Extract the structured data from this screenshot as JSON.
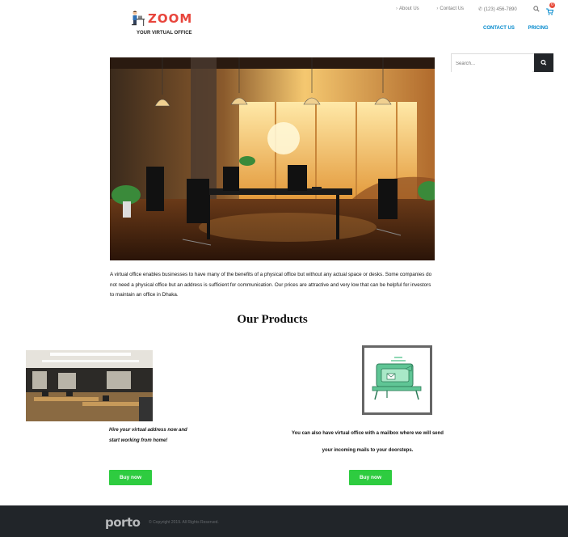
{
  "header": {
    "logo_word": "ZOOM",
    "logo_tagline": "YOUR VIRTUAL OFFICE",
    "top_links": [
      "About Us",
      "Contact Us"
    ],
    "phone": "(123) 456-7890",
    "cart_count": "0",
    "nav": [
      "CONTACT US",
      "PRICING"
    ]
  },
  "search": {
    "placeholder": "Search..."
  },
  "intro": "A virtual office enables businesses to have many of the benefits of a physical office but without any actual space or desks. Some companies do not need a physical office but an address is sufficient for communication. Our prices are attractive and very low that can be helpful for investors to maintain an office in Dhaka.",
  "products": {
    "title": "Our Products",
    "items": [
      {
        "text": "Hire your virtual address now and start working from home!",
        "button": "Buy now"
      },
      {
        "text": "You can also have virtual office with a mailbox where we will send your incoming mails to your doorsteps.",
        "button": "Buy now"
      }
    ]
  },
  "footer": {
    "logo": "porto",
    "copyright": "© Copyright 2019. All Rights Reserved."
  },
  "colors": {
    "accent": "#0088cc",
    "brand": "#e8453c",
    "buy": "#2ecc40",
    "footer": "#212529"
  }
}
